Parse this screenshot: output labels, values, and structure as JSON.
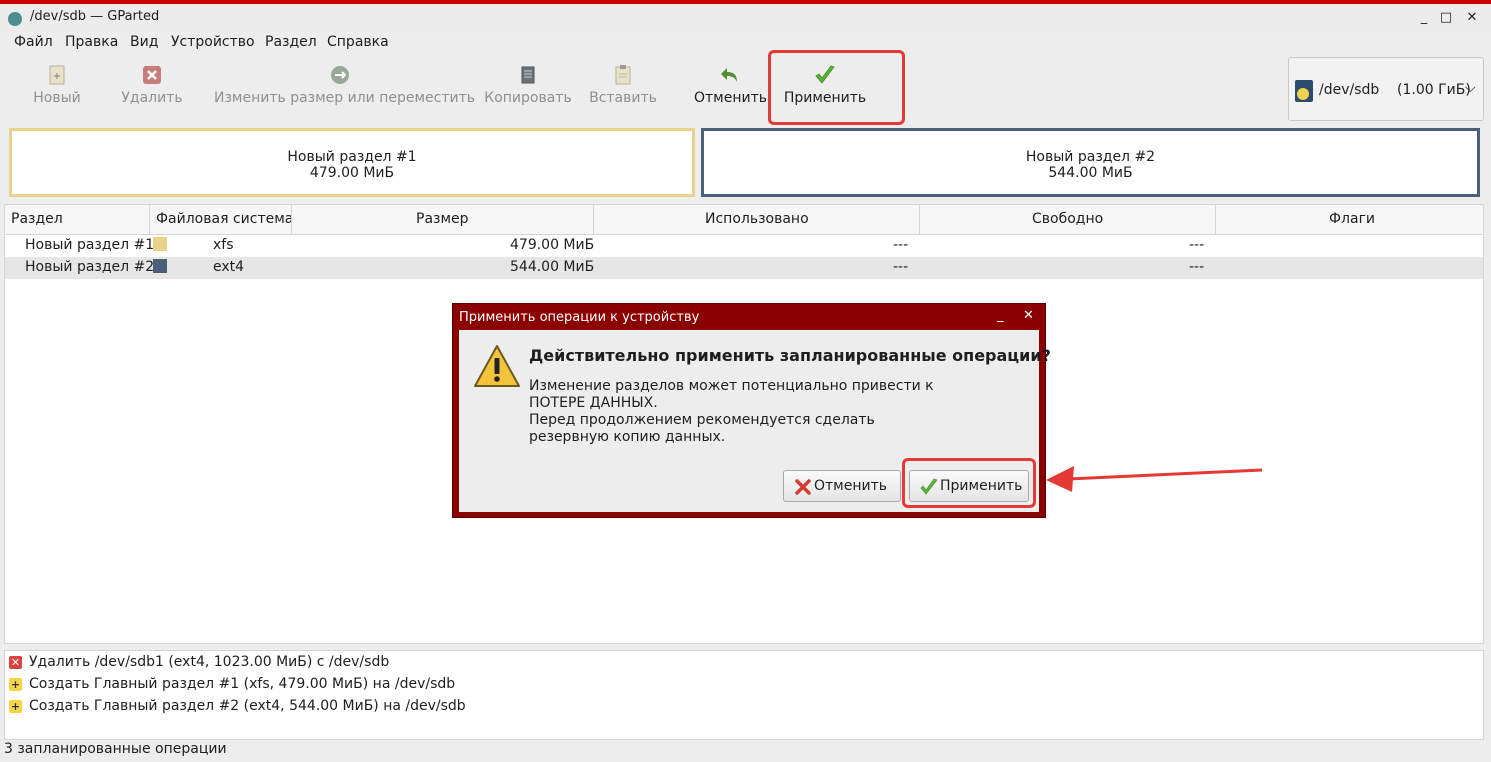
{
  "window": {
    "title": "/dev/sdb — GParted",
    "minimize": "_",
    "maximize": "□",
    "close": "✕"
  },
  "menu": [
    "Файл",
    "Правка",
    "Вид",
    "Устройство",
    "Раздел",
    "Справка"
  ],
  "toolbar": {
    "new": "Новый",
    "delete": "Удалить",
    "resize": "Изменить размер или переместить",
    "copy": "Копировать",
    "paste": "Вставить",
    "undo": "Отменить",
    "apply": "Применить"
  },
  "device": {
    "name": "/dev/sdb",
    "size": "(1.00 ГиБ)"
  },
  "partition_map": [
    {
      "name": "Новый раздел #1",
      "size": "479.00 МиБ",
      "color": "#e8d38b"
    },
    {
      "name": "Новый раздел #2",
      "size": "544.00 МиБ",
      "color": "#4a6079"
    }
  ],
  "table": {
    "headers": [
      "Раздел",
      "Файловая система",
      "Размер",
      "Использовано",
      "Свободно",
      "Флаги"
    ],
    "rows": [
      {
        "name": "Новый раздел #1",
        "fs": "xfs",
        "size": "479.00 МиБ",
        "used": "---",
        "free": "---",
        "flags": "",
        "color": "#e8d38b"
      },
      {
        "name": "Новый раздел #2",
        "fs": "ext4",
        "size": "544.00 МиБ",
        "used": "---",
        "free": "---",
        "flags": "",
        "color": "#4a6079"
      }
    ]
  },
  "operations": [
    {
      "type": "delete",
      "text": "Удалить /dev/sdb1 (ext4, 1023.00 МиБ) с /dev/sdb"
    },
    {
      "type": "create",
      "text": "Создать Главный раздел #1 (xfs, 479.00 МиБ) на /dev/sdb"
    },
    {
      "type": "create",
      "text": "Создать Главный раздел #2 (ext4, 544.00 МиБ) на /dev/sdb"
    }
  ],
  "status": "3 запланированные операции",
  "dialog": {
    "title": "Применить операции к устройству",
    "minimize": "_",
    "close": "✕",
    "heading": "Действительно применить запланированные операции?",
    "line1": "Изменение разделов может потенциально привести к",
    "line2": "ПОТЕРЕ ДАННЫХ.",
    "line3": "Перед продолжением рекомендуется сделать",
    "line4": "резервную копию данных.",
    "cancel": "Отменить",
    "apply": "Применить"
  },
  "accent": "#e53935"
}
